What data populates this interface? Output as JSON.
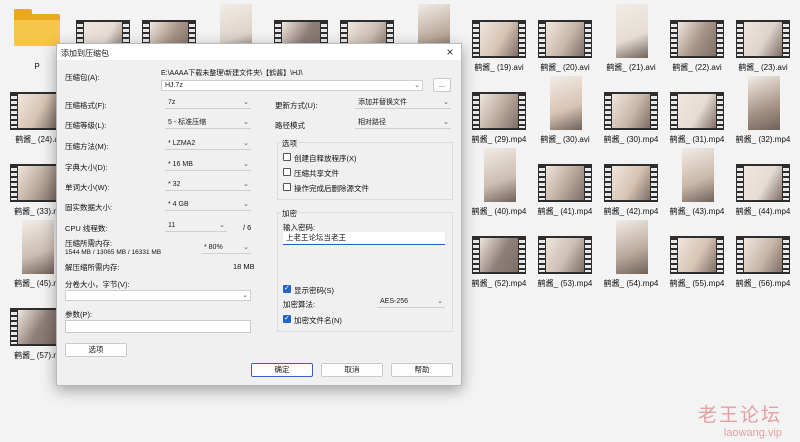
{
  "explorer": {
    "row1": [
      "P",
      "",
      "",
      "",
      "",
      "",
      "",
      "鹤酱_ (19).avi",
      "鹤酱_ (20).avi",
      "鹤酱_ (21).avi",
      "鹤酱_ (22).avi",
      "鹤酱_ (23).avi"
    ],
    "row2": [
      "鹤酱_ (24).a",
      "",
      "",
      "",
      "",
      "",
      "",
      "鹤酱_ (29).mp4",
      "鹤酱_ (30).avi",
      "鹤酱_ (30).mp4",
      "鹤酱_ (31).mp4",
      "鹤酱_ (32).mp4"
    ],
    "row3": [
      "鹤酱_ (33).m",
      "",
      "",
      "",
      "",
      "",
      "",
      "鹤酱_ (40).mp4",
      "鹤酱_ (41).mp4",
      "鹤酱_ (42).mp4",
      "鹤酱_ (43).mp4",
      "鹤酱_ (44).mp4"
    ],
    "row4": [
      "鹤酱_ (45).m",
      "",
      "",
      "",
      "",
      "",
      "",
      "鹤酱_ (52).mp4",
      "鹤酱_ (53).mp4",
      "鹤酱_ (54).mp4",
      "鹤酱_ (55).mp4",
      "鹤酱_ (56).mp4"
    ],
    "row5": [
      "鹤酱_ (57).m"
    ]
  },
  "dialog": {
    "title": "添加到压缩包",
    "archive_label": "压缩包(A):",
    "archive_path": "E:\\AAAA下载未整理\\新建文件夹\\【鹤酱】\\HJ\\",
    "archive_name": "HJ.7z",
    "browse_label": "...",
    "format_label": "压缩格式(F):",
    "format_value": "7z",
    "level_label": "压缩等级(L):",
    "level_value": "5 - 标准压缩",
    "method_label": "压缩方法(M):",
    "method_value": "* LZMA2",
    "dict_label": "字典大小(D):",
    "dict_value": "* 16 MB",
    "word_label": "单词大小(W):",
    "word_value": "* 32",
    "solid_label": "固实数据大小:",
    "solid_value": "* 4 GB",
    "threads_label": "CPU 线程数:",
    "threads_value": "11",
    "threads_total": "/ 6",
    "mem_compress_label": "压缩所需内存:",
    "mem_compress_detail": "1544 MB / 13065 MB / 16331 MB",
    "mem_percent_value": "* 80%",
    "mem_decompress_label": "解压缩所需内存:",
    "mem_decompress_value": "18 MB",
    "split_label": "分卷大小，字节(V):",
    "split_value": "",
    "params_label": "参数(P):",
    "params_value": "",
    "options_button": "选项",
    "update_label": "更新方式(U):",
    "update_value": "添加并替换文件",
    "path_label": "路径模式",
    "path_value": "相对路径",
    "options_group": "选项",
    "opt_sfx": "创建自释放程序(X)",
    "opt_shared": "压缩共享文件",
    "opt_delete": "操作完成后删除源文件",
    "encrypt_group": "加密",
    "password_label": "输入密码:",
    "password_value": "上老王论坛当老王",
    "show_password": "显示密码(S)",
    "method_enc_label": "加密算法:",
    "method_enc_value": "AES-256",
    "encrypt_names": "加密文件名(N)",
    "ok": "确定",
    "cancel": "取消",
    "help": "帮助"
  },
  "watermark": {
    "line1": "老王论坛",
    "line2": "laowang.vip"
  },
  "colors": {
    "accent": "#2563c9",
    "folder": "#e9a91f"
  }
}
